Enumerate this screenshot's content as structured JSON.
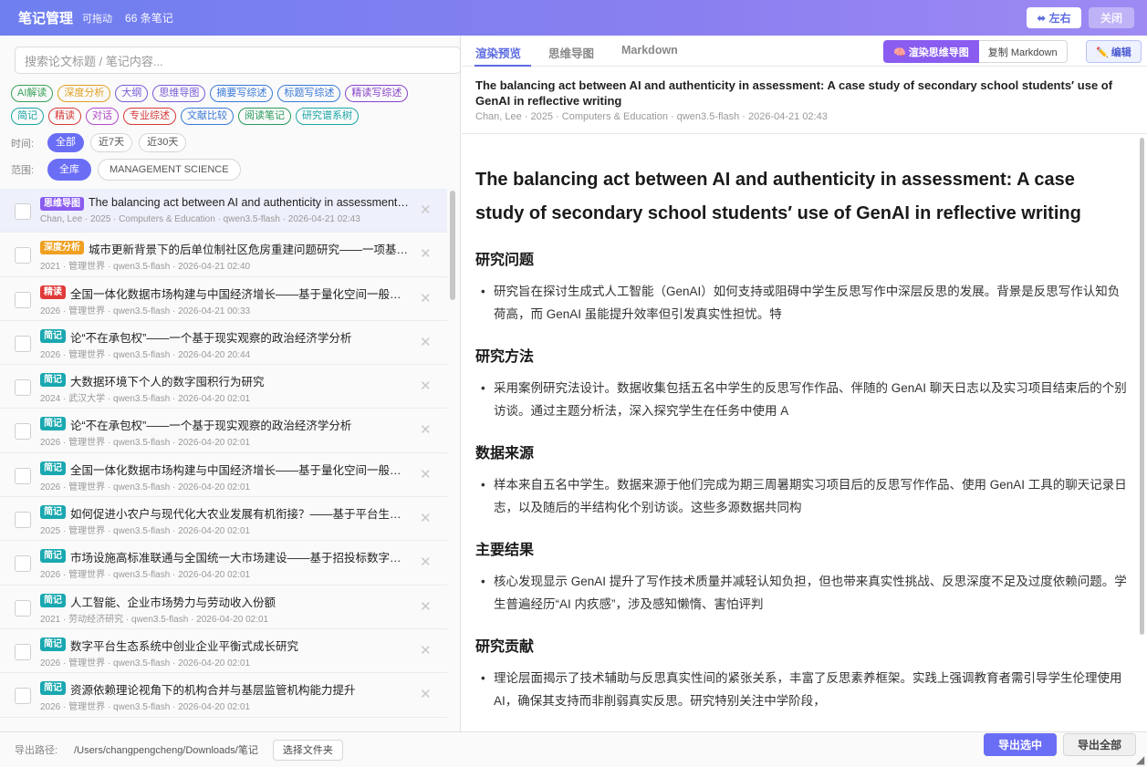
{
  "header": {
    "title": "笔记管理",
    "draggable": "可拖动",
    "count": "66 条笔记",
    "lr_button": "⬌ 左右",
    "close_button": "关闭"
  },
  "search": {
    "placeholder": "搜索论文标题 / 笔记内容..."
  },
  "filter_tags_row1": [
    {
      "label": "AI解读",
      "color": "#3aa15a"
    },
    {
      "label": "深度分析",
      "color": "#e0a020"
    },
    {
      "label": "大纲",
      "color": "#7a5cd8"
    },
    {
      "label": "思维导图",
      "color": "#7a5cd8"
    },
    {
      "label": "摘要写综述",
      "color": "#3b7ad8"
    },
    {
      "label": "标题写综述",
      "color": "#3b7ad8"
    },
    {
      "label": "精读写综述",
      "color": "#8a44c8"
    }
  ],
  "filter_tags_row2": [
    {
      "label": "简记",
      "color": "#1aa5a5"
    },
    {
      "label": "精读",
      "color": "#d83a3a"
    },
    {
      "label": "对话",
      "color": "#b04ac8"
    },
    {
      "label": "专业综述",
      "color": "#d83a3a"
    },
    {
      "label": "文献比较",
      "color": "#3b7ad8"
    },
    {
      "label": "阅读笔记",
      "color": "#2a9a5a"
    },
    {
      "label": "研究谱系树",
      "color": "#1aa5a5"
    }
  ],
  "time_filter": {
    "label": "时间:",
    "options": [
      "全部",
      "近7天",
      "近30天"
    ],
    "active": 0
  },
  "scope_filter": {
    "label": "范围:",
    "options": [
      "全库",
      "MANAGEMENT SCIENCE"
    ],
    "active": 0
  },
  "notes": [
    {
      "badge": "思维导图",
      "badge_color": "#8a5cf0",
      "title": "The balancing act between AI and authenticity in assessment: A case study of secondary school students' use of GenAI in reflective writing",
      "meta": "Chan, Lee · 2025 · Computers & Education · qwen3.5-flash · 2026-04-21 02:43",
      "selected": true
    },
    {
      "badge": "深度分析",
      "badge_color": "#f0a020",
      "title": "城市更新背景下的后单位制社区危房重建问题研究——一项基于扎根理论的探索",
      "meta": "2021 · 管理世界 · qwen3.5-flash · 2026-04-21 02:40"
    },
    {
      "badge": "精读",
      "badge_color": "#e03a3a",
      "title": "全国一体化数据市场构建与中国经济增长——基于量化空间一般均衡模型的分析",
      "meta": "2026 · 管理世界 · qwen3.5-flash · 2026-04-21 00:33"
    },
    {
      "badge": "简记",
      "badge_color": "#1aa8b0",
      "title": "论“不在承包权”——一个基于现实观察的政治经济学分析",
      "meta": "2026 · 管理世界 · qwen3.5-flash · 2026-04-20 20:44"
    },
    {
      "badge": "简记",
      "badge_color": "#1aa8b0",
      "title": "大数据环境下个人的数字囤积行为研究",
      "meta": "2024 · 武汉大学 · qwen3.5-flash · 2026-04-20 02:01"
    },
    {
      "badge": "简记",
      "badge_color": "#1aa8b0",
      "title": "论“不在承包权”——一个基于现实观察的政治经济学分析",
      "meta": "2026 · 管理世界 · qwen3.5-flash · 2026-04-20 02:01"
    },
    {
      "badge": "简记",
      "badge_color": "#1aa8b0",
      "title": "全国一体化数据市场构建与中国经济增长——基于量化空间一般均衡模型的分析",
      "meta": "2026 · 管理世界 · qwen3.5-flash · 2026-04-20 02:01"
    },
    {
      "badge": "简记",
      "badge_color": "#1aa8b0",
      "title": "如何促进小农户与现代化大农业发展有机衔接？——基于平台生态系统的视角",
      "meta": "2025 · 管理世界 · qwen3.5-flash · 2026-04-20 02:01"
    },
    {
      "badge": "简记",
      "badge_color": "#1aa8b0",
      "title": "市场设施高标准联通与全国统一大市场建设——基于招投标数字证书互认的证据",
      "meta": "2026 · 管理世界 · qwen3.5-flash · 2026-04-20 02:01"
    },
    {
      "badge": "简记",
      "badge_color": "#1aa8b0",
      "title": "人工智能、企业市场势力与劳动收入份额",
      "meta": "2021 · 劳动经济研究 · qwen3.5-flash · 2026-04-20 02:01"
    },
    {
      "badge": "简记",
      "badge_color": "#1aa8b0",
      "title": "数字平台生态系统中创业企业平衡式成长研究",
      "meta": "2026 · 管理世界 · qwen3.5-flash · 2026-04-20 02:01"
    },
    {
      "badge": "简记",
      "badge_color": "#1aa8b0",
      "title": "资源依赖理论视角下的机构合并与基层监管机构能力提升",
      "meta": "2026 · 管理世界 · qwen3.5-flash · 2026-04-20 02:01"
    }
  ],
  "tabs": [
    "渲染预览",
    "思维导图",
    "Markdown"
  ],
  "actions": {
    "render_mindmap": "🧠 渲染思维导图",
    "copy_markdown": "复制 Markdown",
    "edit": "✏️ 编辑"
  },
  "doc": {
    "title": "The balancing act between AI and authenticity in assessment: A case study of secondary school students′ use of GenAI in reflective writing",
    "meta": "Chan, Lee · 2025 · Computers & Education · qwen3.5-flash · 2026-04-21 02:43",
    "heading": "The balancing act between AI and authenticity in assessment: A case study of secondary school students′ use of GenAI in reflective writing",
    "sections": [
      {
        "title": "研究问题",
        "text": "研究旨在探讨生成式人工智能（GenAI）如何支持或阻碍中学生反思写作中深层反思的发展。背景是反思写作认知负荷高，而 GenAI 虽能提升效率但引发真实性担忧。特"
      },
      {
        "title": "研究方法",
        "text": "采用案例研究法设计。数据收集包括五名中学生的反思写作作品、伴随的 GenAI 聊天日志以及实习项目结束后的个别访谈。通过主题分析法，深入探究学生在任务中使用 A"
      },
      {
        "title": "数据来源",
        "text": "样本来自五名中学生。数据来源于他们完成为期三周暑期实习项目后的反思写作作品、使用 GenAI 工具的聊天记录日志，以及随后的半结构化个别访谈。这些多源数据共同构"
      },
      {
        "title": "主要结果",
        "text": "核心发现显示 GenAI 提升了写作技术质量并减轻认知负担，但也带来真实性挑战、反思深度不足及过度依赖问题。学生普遍经历“AI 内疚感”，涉及感知懒惰、害怕评判"
      },
      {
        "title": "研究贡献",
        "text": "理论层面揭示了技术辅助与反思真实性间的紧张关系，丰富了反思素养框架。实践上强调教育者需引导学生伦理使用 AI，确保其支持而非削弱真实反思。研究特别关注中学阶段，"
      }
    ]
  },
  "footer": {
    "export_label": "导出路径:",
    "path": "/Users/changpengcheng/Downloads/笔记",
    "choose_folder": "选择文件夹",
    "export_selected": "导出选中",
    "export_all": "导出全部"
  }
}
